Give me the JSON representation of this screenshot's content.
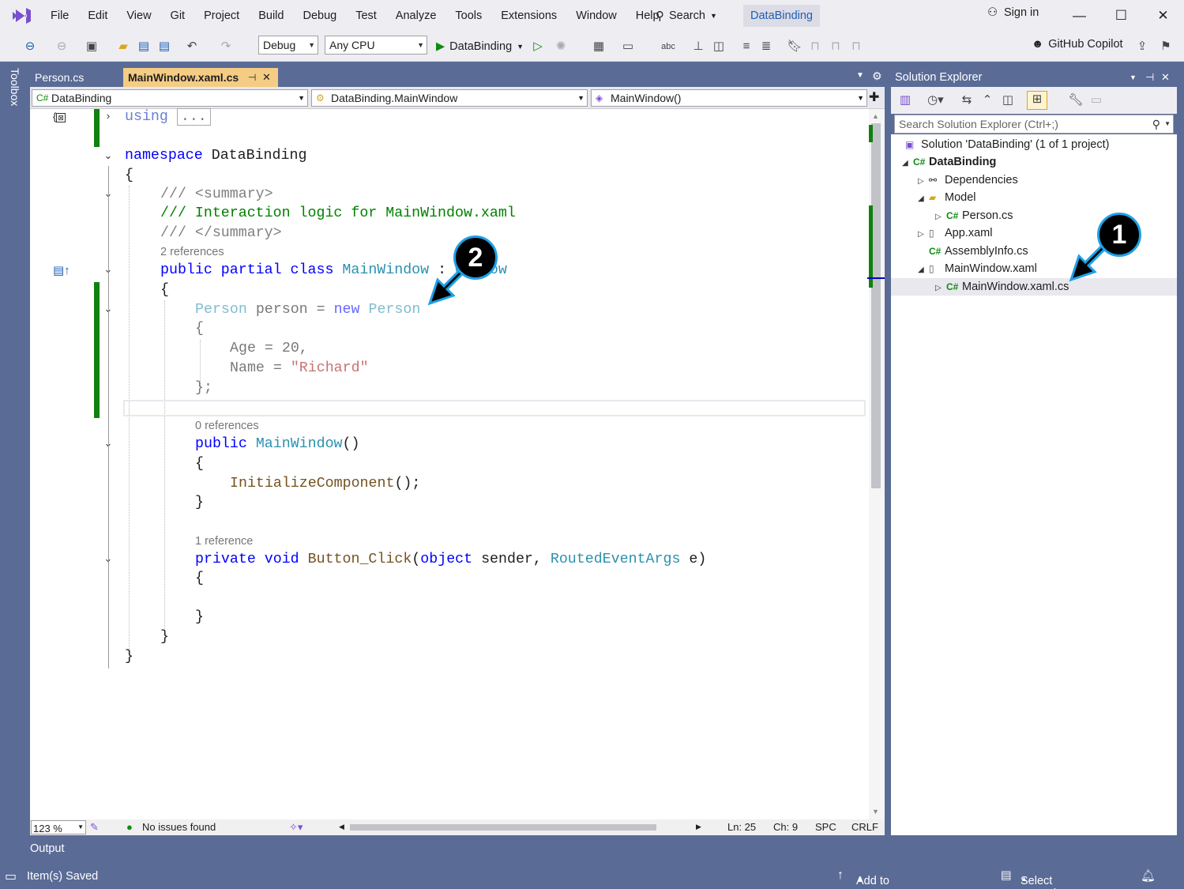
{
  "menu": [
    "File",
    "Edit",
    "View",
    "Git",
    "Project",
    "Build",
    "Debug",
    "Test",
    "Analyze",
    "Tools",
    "Extensions",
    "Window",
    "Help"
  ],
  "search_label": "Search",
  "solution_title": "DataBinding",
  "sign_in": "Sign in",
  "window_controls": {
    "minimize": "—",
    "maximize": "☐",
    "close": "✕"
  },
  "toolbar": {
    "configuration": "Debug",
    "platform": "Any CPU",
    "start_target": "DataBinding",
    "copilot": "GitHub Copilot"
  },
  "toolbox_label": "Toolbox",
  "tabs": [
    {
      "label": "Person.cs",
      "active": false
    },
    {
      "label": "MainWindow.xaml.cs",
      "active": true,
      "pin": "⊣",
      "close": "✕"
    }
  ],
  "navbar": {
    "project": "DataBinding",
    "type": "DataBinding.MainWindow",
    "member": "MainWindow()"
  },
  "code": {
    "using_kw": "using",
    "using_collapsed": "...",
    "l_namespace_kw": "namespace",
    "l_namespace_name": "DataBinding",
    "open_brace": "{",
    "close_brace": "}",
    "doc1": "/// <summary>",
    "doc2": "/// Interaction logic for MainWindow.xaml",
    "doc3": "/// </summary>",
    "lens_class": "2 references",
    "class_mods": "public partial class",
    "class_name": "MainWindow",
    "class_base_sep": " : ",
    "class_base": "Window",
    "field_type": "Person",
    "field_name": "person",
    "field_eq": " = ",
    "field_new": "new",
    "field_ctor": "Person",
    "init_age_name": "Age",
    "init_age_eq": " = ",
    "init_age_val": "20,",
    "init_name_name": "Name",
    "init_name_eq": " = ",
    "init_name_val": "\"Richard\"",
    "close_init": "};",
    "lens_ctor": "0 references",
    "ctor_public": "public",
    "ctor_name": "MainWindow",
    "ctor_parens": "()",
    "init_call": "InitializeComponent",
    "init_call_tail": "();",
    "lens_btn": "1 reference",
    "btn_mods": "private void",
    "btn_name": "Button_Click",
    "btn_open": "(",
    "btn_object": "object",
    "btn_sender": " sender, ",
    "btn_argtype": "RoutedEventArgs",
    "btn_tail": " e)"
  },
  "editor_status": {
    "zoom": "123 %",
    "issues": "No issues found",
    "line": "Ln: 25",
    "char": "Ch: 9",
    "ws": "SPC",
    "eol": "CRLF"
  },
  "output_label": "Output",
  "statusbar": {
    "saved": "Item(s) Saved",
    "source_control": "Add to Source Control",
    "repository": "Select Repository"
  },
  "solution_explorer": {
    "title": "Solution Explorer",
    "search_placeholder": "Search Solution Explorer (Ctrl+;)",
    "tree": [
      {
        "label": "Solution 'DataBinding' (1 of 1 project)",
        "icon": "solution-icon"
      },
      {
        "label": "DataBinding",
        "icon": "csharp-project-icon"
      },
      {
        "label": "Dependencies",
        "icon": "dependencies-icon"
      },
      {
        "label": "Model",
        "icon": "folder-icon"
      },
      {
        "label": "Person.cs",
        "icon": "csharp-file-icon"
      },
      {
        "label": "App.xaml",
        "icon": "xaml-file-icon"
      },
      {
        "label": "AssemblyInfo.cs",
        "icon": "csharp-file-icon"
      },
      {
        "label": "MainWindow.xaml",
        "icon": "xaml-file-icon"
      },
      {
        "label": "MainWindow.xaml.cs",
        "icon": "csharp-file-icon"
      }
    ]
  },
  "callouts": [
    "1",
    "2"
  ],
  "colors": {
    "frame": "#5a6b96",
    "active_tab": "#f5cc84",
    "keyword": "#0000ff",
    "type": "#2b91af",
    "comment": "#008000",
    "string": "#a31515",
    "change_bar": "#108010",
    "callout_border": "#1ea0e6"
  }
}
